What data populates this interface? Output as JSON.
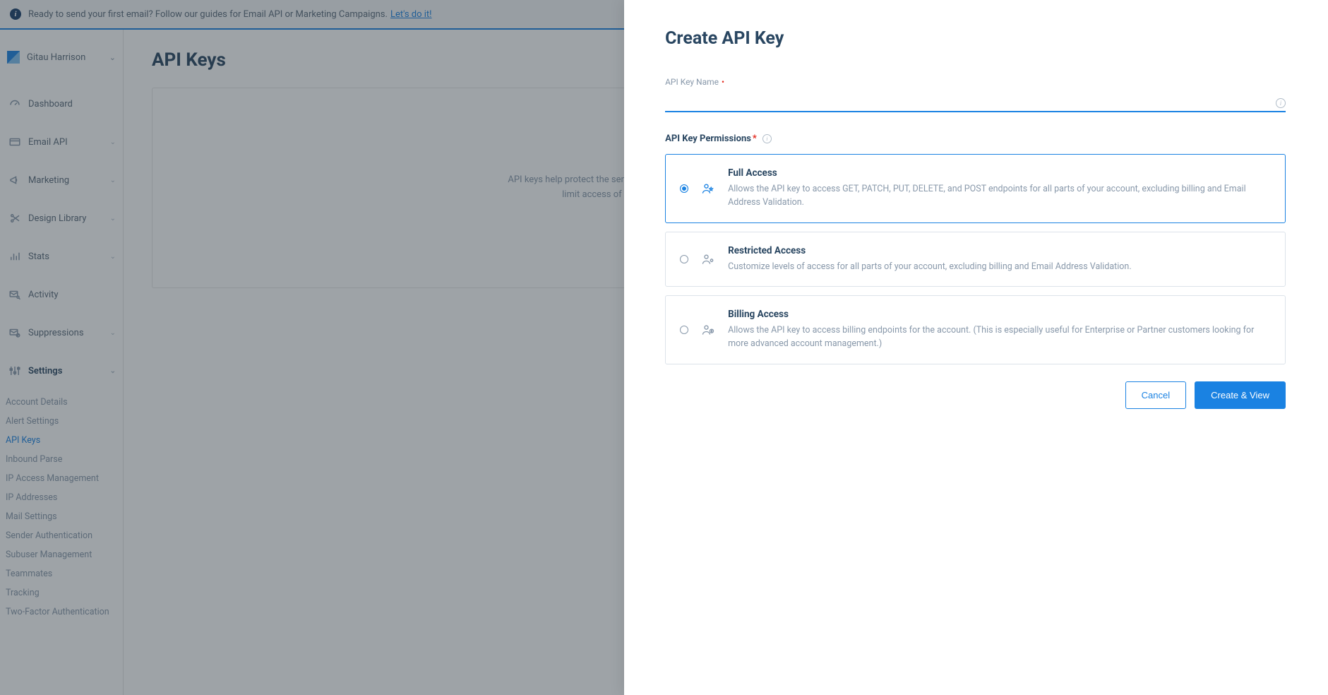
{
  "banner": {
    "text": "Ready to send your first email? Follow our guides for Email API or Marketing Campaigns.",
    "link_text": "Let's do it!"
  },
  "account": {
    "name": "Gitau Harrison"
  },
  "sidebar": [
    {
      "label": "Dashboard",
      "icon": "gauge",
      "expandable": false
    },
    {
      "label": "Email API",
      "icon": "card",
      "expandable": true
    },
    {
      "label": "Marketing",
      "icon": "megaphone",
      "expandable": true
    },
    {
      "label": "Design Library",
      "icon": "scissors",
      "expandable": true
    },
    {
      "label": "Stats",
      "icon": "bars",
      "expandable": true
    },
    {
      "label": "Activity",
      "icon": "envelope",
      "expandable": false
    },
    {
      "label": "Suppressions",
      "icon": "blockmail",
      "expandable": true
    },
    {
      "label": "Settings",
      "icon": "sliders",
      "expandable": true,
      "active": true
    }
  ],
  "settings_submenu": [
    "Account Details",
    "Alert Settings",
    "API Keys",
    "Inbound Parse",
    "IP Access Management",
    "IP Addresses",
    "Mail Settings",
    "Sender Authentication",
    "Subuser Management",
    "Teammates",
    "Tracking",
    "Two-Factor Authentication"
  ],
  "settings_submenu_active": "API Keys",
  "page": {
    "title": "API Keys",
    "empty_line1": "API keys help protect the sensitive areas of your SendGrid account (e.g., contacts and account settings). To",
    "empty_line2": "limit access of API keys, assign one of three levels of customizable permissions."
  },
  "drawer": {
    "title": "Create API Key",
    "name_label": "API Key Name",
    "name_value": "",
    "perm_label": "API Key Permissions",
    "options": [
      {
        "title": "Full Access",
        "desc": "Allows the API key to access GET, PATCH, PUT, DELETE, and POST endpoints for all parts of your account, excluding billing and Email Address Validation.",
        "selected": true
      },
      {
        "title": "Restricted Access",
        "desc": "Customize levels of access for all parts of your account, excluding billing and Email Address Validation.",
        "selected": false
      },
      {
        "title": "Billing Access",
        "desc": "Allows the API key to access billing endpoints for the account. (This is especially useful for Enterprise or Partner customers looking for more advanced account management.)",
        "selected": false
      }
    ],
    "cancel_label": "Cancel",
    "submit_label": "Create & View"
  }
}
